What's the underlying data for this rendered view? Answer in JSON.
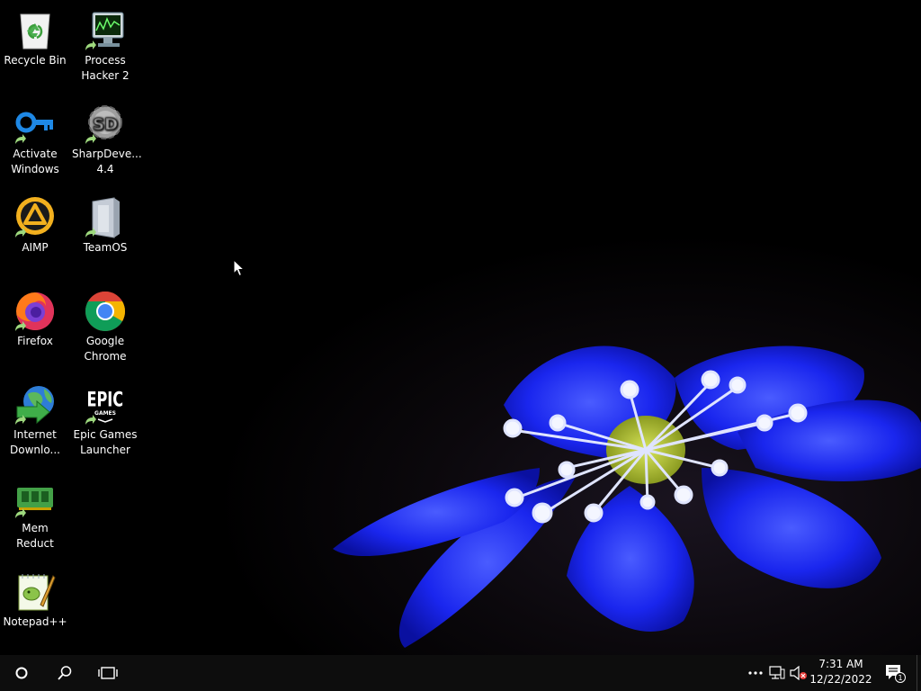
{
  "desktop": {
    "icons": [
      {
        "label": "Recycle Bin",
        "icon": "recycle-bin-icon"
      },
      {
        "label": "Process\nHacker 2",
        "icon": "process-hacker-icon"
      },
      {
        "label": "Activate\nWindows",
        "icon": "key-icon"
      },
      {
        "label": "SharpDeve...\n4.4",
        "icon": "sharpdevelop-icon"
      },
      {
        "label": "AIMP",
        "icon": "aimp-icon"
      },
      {
        "label": "TeamOS",
        "icon": "teamos-icon"
      },
      {
        "label": "Firefox",
        "icon": "firefox-icon"
      },
      {
        "label": "Google\nChrome",
        "icon": "chrome-icon"
      },
      {
        "label": "Internet\nDownlo...",
        "icon": "internet-download-manager-icon"
      },
      {
        "label": "Epic Games\nLauncher",
        "icon": "epic-games-icon"
      },
      {
        "label": "Mem Reduct",
        "icon": "mem-reduct-icon"
      },
      {
        "label": "Notepad++",
        "icon": "notepad-plus-plus-icon"
      }
    ]
  },
  "taskbar": {
    "start_icon": "start-circle-icon",
    "search_icon": "search-icon",
    "task_view_icon": "task-view-icon",
    "tray": {
      "overflow_icon": "more-icon",
      "network_icon": "network-icon",
      "volume_icon": "volume-muted-icon"
    },
    "clock": {
      "time": "7:31 AM",
      "date": "12/22/2022"
    },
    "notifications": {
      "icon": "action-center-icon",
      "count": "1"
    }
  },
  "colors": {
    "taskbar": "#0d0d0d",
    "flower": "#1a2cff",
    "accent": "#ffffff"
  }
}
